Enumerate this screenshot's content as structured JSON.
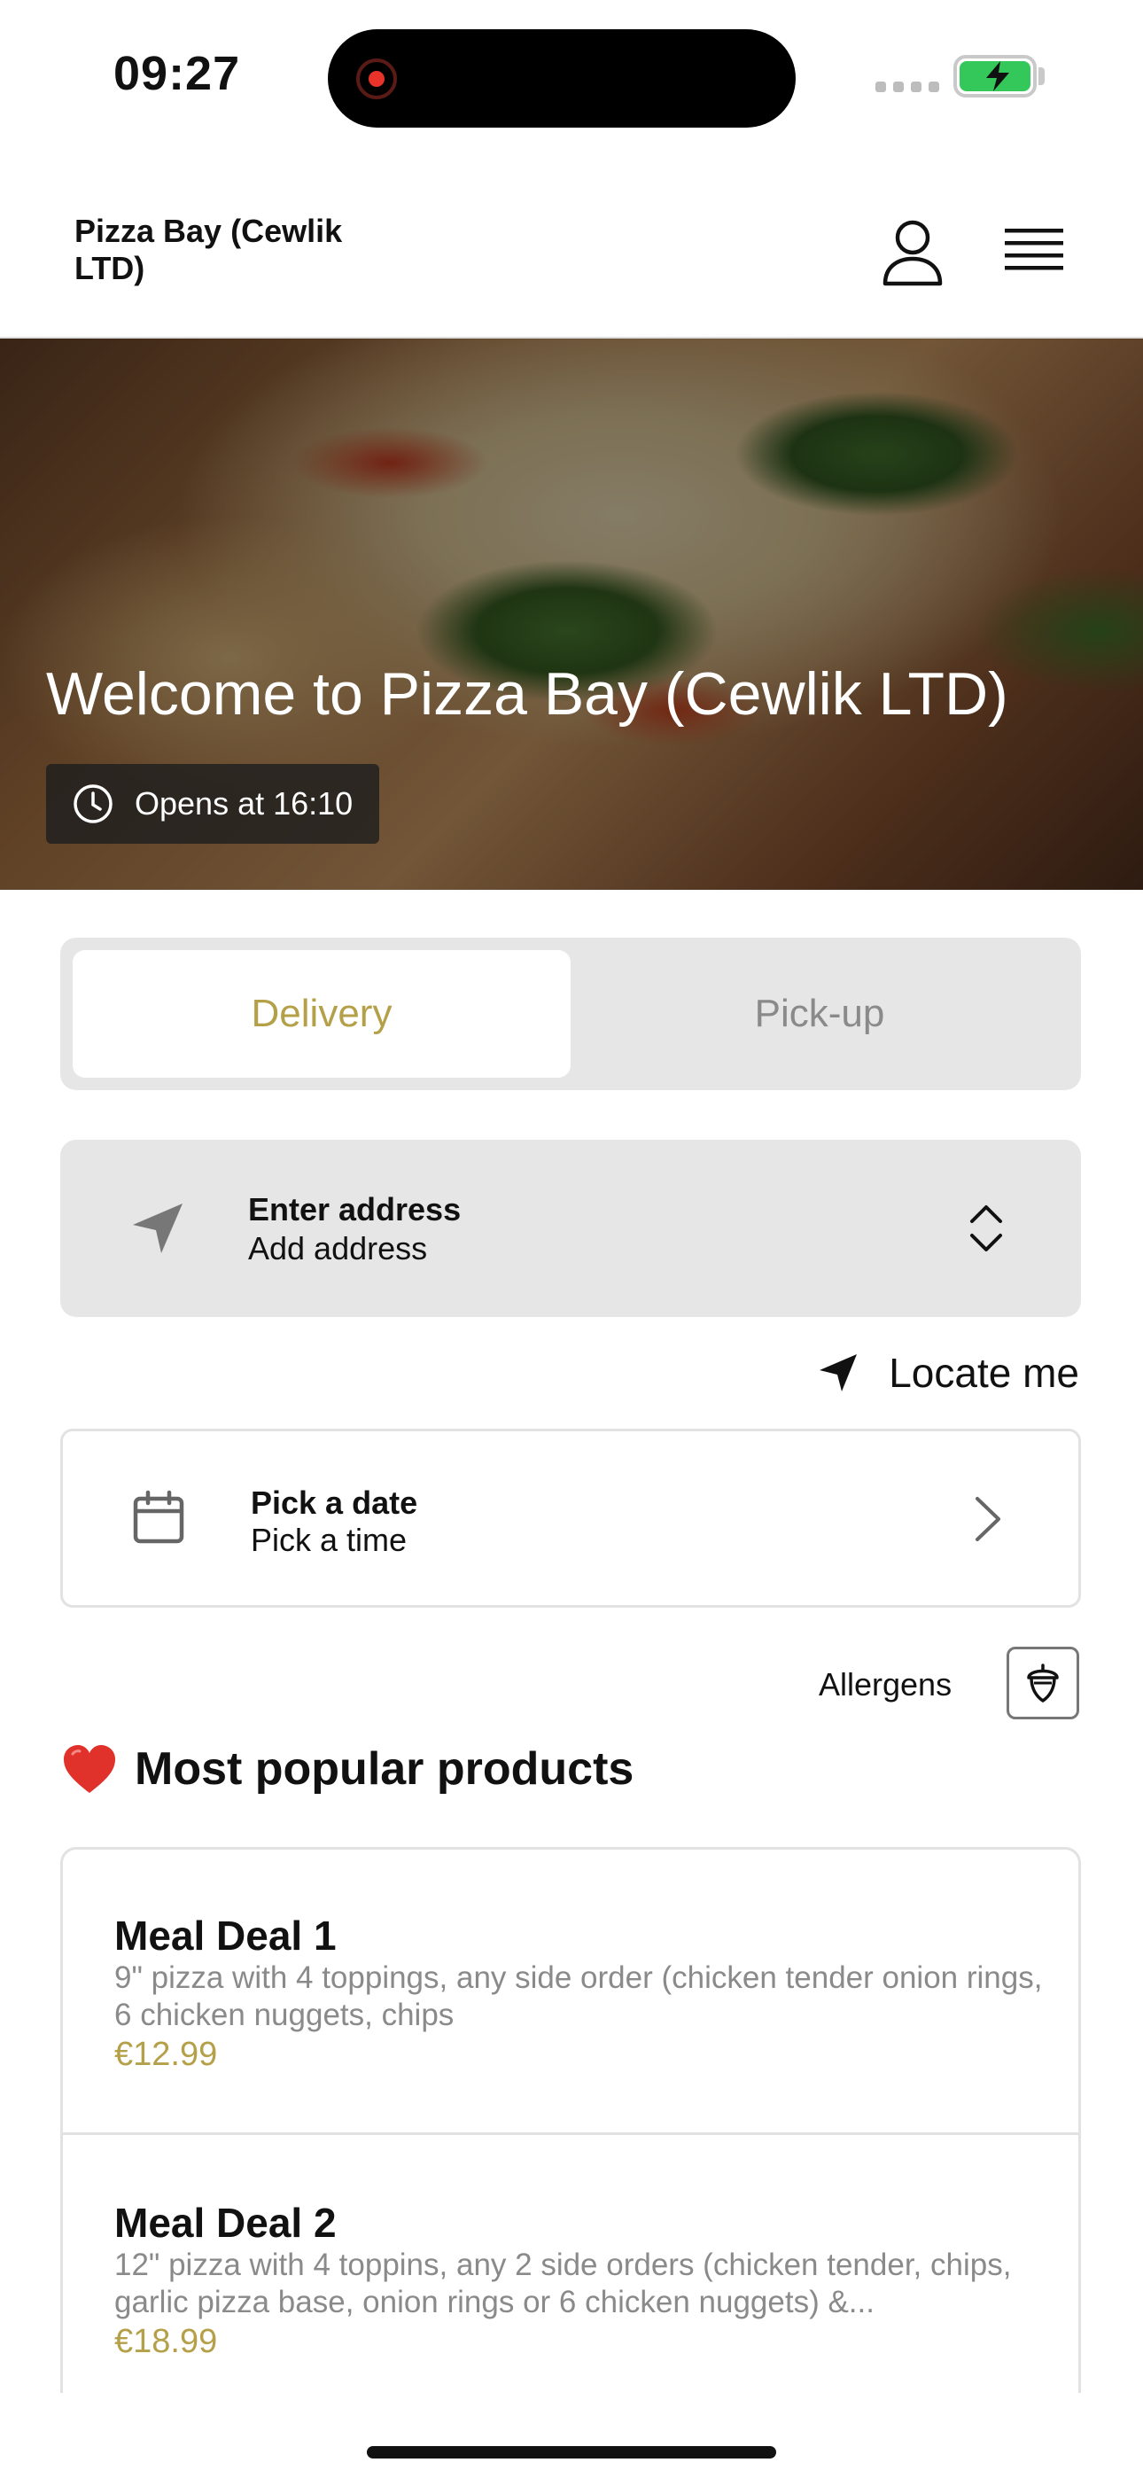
{
  "status_bar": {
    "time": "09:27"
  },
  "header": {
    "brand": "Pizza Bay (Cewlik LTD)"
  },
  "hero": {
    "title": "Welcome to Pizza Bay (Cewlik LTD)",
    "hours": "Opens at 16:10"
  },
  "order_mode": {
    "options": [
      "Delivery",
      "Pick-up"
    ],
    "selected": "Delivery"
  },
  "address": {
    "title": "Enter address",
    "subtitle": "Add address"
  },
  "locate": {
    "label": "Locate me"
  },
  "schedule": {
    "title": "Pick a date",
    "subtitle": "Pick a time"
  },
  "allergens": {
    "label": "Allergens"
  },
  "popular": {
    "title": "Most popular products",
    "products": [
      {
        "name": "Meal Deal 1",
        "description": "9\" pizza with 4 toppings, any side order (chicken tender onion rings, 6 chicken nuggets, chips",
        "price": "€12.99"
      },
      {
        "name": "Meal Deal 2",
        "description": "12\" pizza with 4 toppins, any 2 side orders (chicken tender, chips, garlic pizza base, onion rings or 6 chicken nuggets) &...",
        "price": "€18.99"
      }
    ]
  },
  "colors": {
    "accent": "#b5a04a",
    "battery": "#34c759",
    "card_bg": "#e6e6e6"
  }
}
